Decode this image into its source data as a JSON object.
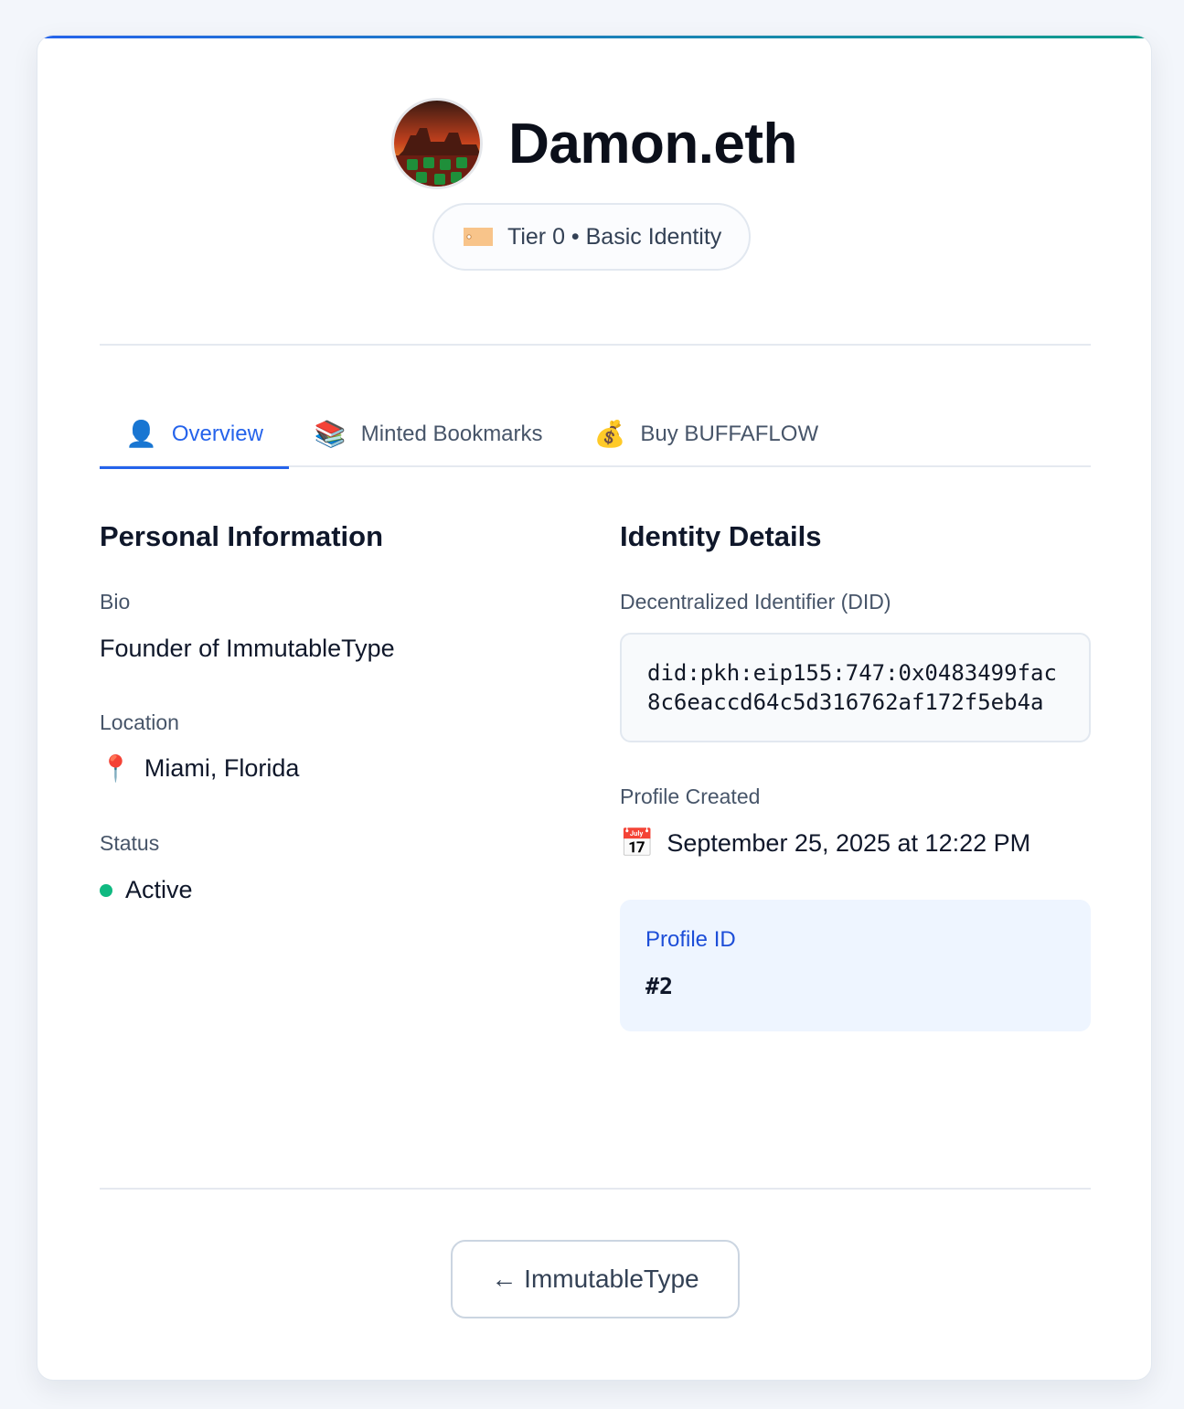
{
  "profile": {
    "name": "Damon.eth",
    "tier_badge": "Tier 0 • Basic Identity"
  },
  "tabs": [
    {
      "icon": "👤",
      "label": "Overview",
      "active": true
    },
    {
      "icon": "📚",
      "label": "Minted Bookmarks",
      "active": false
    },
    {
      "icon": "💰",
      "label": "Buy BUFFAFLOW",
      "active": false
    }
  ],
  "personal": {
    "title": "Personal Information",
    "bio_label": "Bio",
    "bio_value": "Founder of ImmutableType",
    "location_label": "Location",
    "location_icon": "📍",
    "location_value": "Miami, Florida",
    "status_label": "Status",
    "status_value": "Active",
    "status_color": "#10b981"
  },
  "identity": {
    "title": "Identity Details",
    "did_label": "Decentralized Identifier (DID)",
    "did_value": "did:pkh:eip155:747:0x0483499fac8c6eaccd64c5d316762af172f5eb4a",
    "created_label": "Profile Created",
    "created_icon": "📅",
    "created_value": "September 25, 2025 at 12:22 PM",
    "profile_id_label": "Profile ID",
    "profile_id_value": "#2"
  },
  "footer": {
    "back_label": "← ImmutableType"
  },
  "colors": {
    "accent": "#2563eb",
    "accent_gradient_end": "#0f9d8a",
    "status_active": "#10b981"
  }
}
